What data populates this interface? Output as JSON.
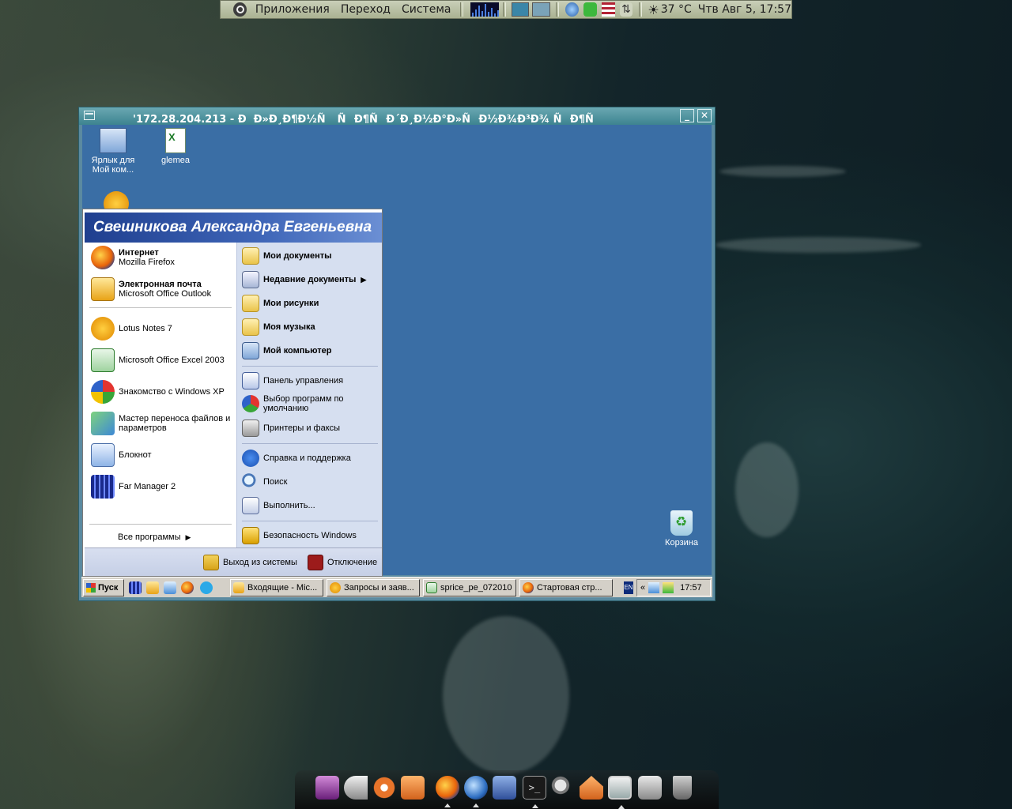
{
  "top_panel": {
    "menus": [
      "Приложения",
      "Переход",
      "Система"
    ],
    "weather": "37 °C",
    "clock": "Чтв Авг  5, 17:57"
  },
  "rdp_window": {
    "title": "'172.28.204.213 - ÐÐ»Ð¸Ð¶Ð½Ñ ÑÐ¶ÑÐ´Ð¸Ð½Ð°Ð»ÑÐ½Ð¾Ð³Ð¾ ÑÐ¶Ñ"
  },
  "remote_desktop": {
    "icons": [
      {
        "label": "Ярлык для Мой ком..."
      },
      {
        "label": "glemea"
      },
      {
        "label": "Корзина"
      }
    ]
  },
  "start_menu": {
    "user_name": "Свешникова Александра Евгеньевна",
    "pinned": [
      {
        "title": "Интернет",
        "subtitle": "Mozilla Firefox"
      },
      {
        "title": "Электронная почта",
        "subtitle": "Microsoft Office Outlook"
      }
    ],
    "recent": [
      "Lotus Notes 7",
      "Microsoft Office Excel 2003",
      "Знакомство с Windows XP",
      "Мастер переноса файлов и параметров",
      "Блокнот",
      "Far Manager 2"
    ],
    "all_programs": "Все программы",
    "places": [
      "Мои документы",
      "Недавние документы",
      "Мои рисунки",
      "Моя музыка",
      "Мой компьютер"
    ],
    "settings": [
      "Панель управления",
      "Выбор программ по умолчанию",
      "Принтеры и факсы"
    ],
    "help": [
      "Справка и поддержка",
      "Поиск",
      "Выполнить..."
    ],
    "security": "Безопасность Windows",
    "logoff": "Выход из системы",
    "shutdown": "Отключение"
  },
  "xp_taskbar": {
    "start_label": "Пуск",
    "tasks": [
      "Входящие - Mic...",
      "Запросы и заяв...",
      "sprice_pe_072010",
      "Стартовая стр..."
    ],
    "lang": "EN",
    "tray_chevron": "«",
    "clock": "17:57"
  },
  "dock": {
    "items": [
      "video-icon",
      "volume-icon",
      "ubuntu-icon",
      "folder-icon",
      "firefox-icon",
      "thunderbird-icon",
      "save-icon",
      "terminal-icon",
      "search-icon",
      "home-icon",
      "window-icon",
      "camera-icon",
      "trash-icon"
    ]
  }
}
